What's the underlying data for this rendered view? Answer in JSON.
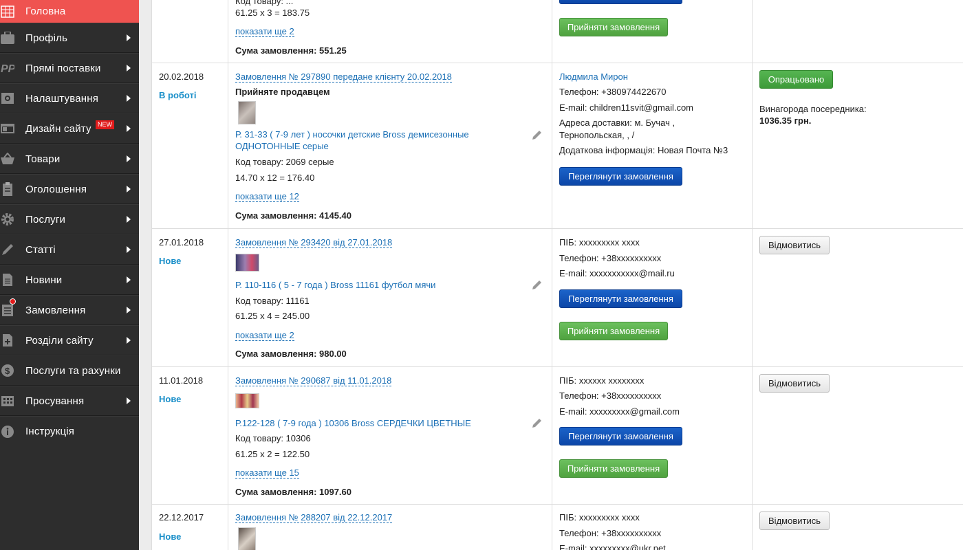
{
  "sidebar": {
    "items": [
      {
        "label": "Головна",
        "icon": "grid-icon"
      },
      {
        "label": "Профіль",
        "icon": "briefcase-icon"
      },
      {
        "label": "Прямі поставки",
        "icon": "pp-icon"
      },
      {
        "label": "Налаштування",
        "icon": "settings-icon"
      },
      {
        "label": "Дизайн сайту",
        "icon": "window-icon",
        "badge": "NEW"
      },
      {
        "label": "Товари",
        "icon": "basket-icon"
      },
      {
        "label": "Оголошення",
        "icon": "clipboard-icon"
      },
      {
        "label": "Послуги",
        "icon": "gear-icon"
      },
      {
        "label": "Статті",
        "icon": "pencil-icon"
      },
      {
        "label": "Новини",
        "icon": "document-icon"
      },
      {
        "label": "Замовлення",
        "icon": "receipt-icon"
      },
      {
        "label": "Розділи сайту",
        "icon": "add-file-icon"
      },
      {
        "label": "Послуги та рахунки",
        "icon": "dollar-icon"
      },
      {
        "label": "Просування",
        "icon": "building-icon"
      },
      {
        "label": "Інструкція",
        "icon": "info-icon"
      }
    ]
  },
  "orders": [
    {
      "qty_line": "61.25 x 3 = 183.75",
      "show_more": "показати ще 2",
      "total": "Сума замовлення: 551.25",
      "btn_view": "",
      "btn_accept": "Прийняти замовлення"
    },
    {
      "date": "20.02.2018",
      "status": "В роботі",
      "title": "Замовлення № 297890 передане клієнту 20.02.2018",
      "accepted": "Прийняте продавцем",
      "product": "Р. 31-33 ( 7-9 лет ) носочки детские Bross демисезонные",
      "product2": "ОДНОТОННЫЕ серые",
      "code": "Код товару: 2069 серые",
      "qty_line": "14.70 x 12 = 176.40",
      "show_more": "показати ще 12",
      "total": "Сума замовлення: 4145.40",
      "customer": "Людмила Мирон",
      "phone": "Телефон: +380974422670",
      "email": "E-mail: children11svit@gmail.com",
      "address": "Адреса доставки: м. Бучач ,",
      "address2": "Тернопольская, , /",
      "extra": "Додаткова інформація: Новая Почта №3",
      "btn_view": "Переглянути замовлення",
      "btn_done": "Опрацьовано",
      "reward_label": "Винагорода посередника:",
      "reward_value": "1036.35 грн."
    },
    {
      "date": "27.01.2018",
      "status": "Нове",
      "title": "Замовлення № 293420 від 27.01.2018",
      "product": "Р. 110-116 ( 5 - 7 года ) Bross 11161 футбол мячи",
      "code": "Код товару: 11161",
      "qty_line": "61.25 x 4 = 245.00",
      "show_more": "показати ще 2",
      "total": "Сума замовлення: 980.00",
      "name": "ПІБ: xxxxxxxxx xxxx",
      "phone": "Телефон: +38xxxxxxxxxx",
      "email": "E-mail: xxxxxxxxxxx@mail.ru",
      "btn_view": "Переглянути замовлення",
      "btn_accept": "Прийняти замовлення",
      "btn_refuse": "Відмовитись"
    },
    {
      "date": "11.01.2018",
      "status": "Нове",
      "title": "Замовлення № 290687 від 11.01.2018",
      "product": "Р.122-128 ( 7-9 года ) 10306 Bross СЕРДЕЧКИ ЦВЕТНЫЕ",
      "code": "Код товару: 10306",
      "qty_line": "61.25 x 2 = 122.50",
      "show_more": "показати ще 15",
      "total": "Сума замовлення: 1097.60",
      "name": "ПІБ: xxxxxx xxxxxxxx",
      "phone": "Телефон: +38xxxxxxxxxx",
      "email": "E-mail: xxxxxxxxx@gmail.com",
      "btn_view": "Переглянути замовлення",
      "btn_accept": "Прийняти замовлення",
      "btn_refuse": "Відмовитись"
    },
    {
      "date": "22.12.2017",
      "status": "Нове",
      "title": "Замовлення № 288207 від 22.12.2017",
      "name": "ПІБ: xxxxxxxxx xxxx",
      "phone": "Телефон: +38xxxxxxxxxx",
      "email": "E-mail: xxxxxxxxx@ukr.net",
      "btn_refuse": "Відмовитись"
    }
  ],
  "colors": {
    "sidebar_bg": "#2d2d2d",
    "active": "#ef5350",
    "link": "#1a6fb5",
    "status": "#1a8fc9"
  }
}
